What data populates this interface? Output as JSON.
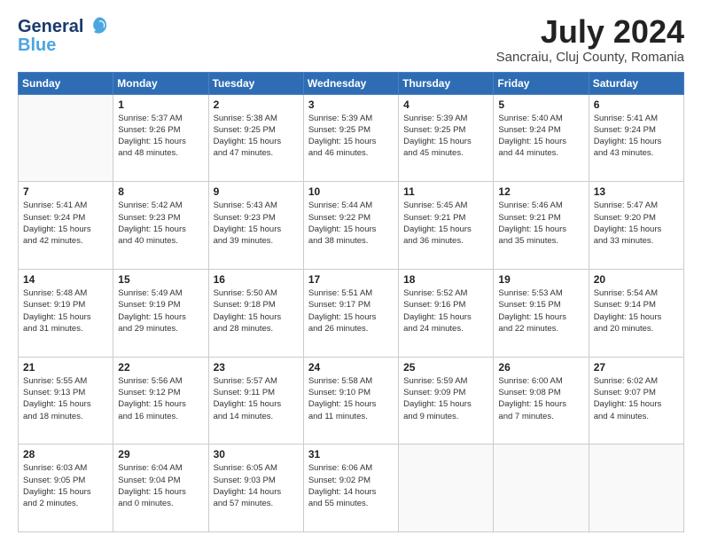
{
  "logo": {
    "line1": "General",
    "line2": "Blue"
  },
  "title": "July 2024",
  "subtitle": "Sancraiu, Cluj County, Romania",
  "headers": [
    "Sunday",
    "Monday",
    "Tuesday",
    "Wednesday",
    "Thursday",
    "Friday",
    "Saturday"
  ],
  "weeks": [
    [
      {
        "num": "",
        "info": ""
      },
      {
        "num": "1",
        "info": "Sunrise: 5:37 AM\nSunset: 9:26 PM\nDaylight: 15 hours\nand 48 minutes."
      },
      {
        "num": "2",
        "info": "Sunrise: 5:38 AM\nSunset: 9:25 PM\nDaylight: 15 hours\nand 47 minutes."
      },
      {
        "num": "3",
        "info": "Sunrise: 5:39 AM\nSunset: 9:25 PM\nDaylight: 15 hours\nand 46 minutes."
      },
      {
        "num": "4",
        "info": "Sunrise: 5:39 AM\nSunset: 9:25 PM\nDaylight: 15 hours\nand 45 minutes."
      },
      {
        "num": "5",
        "info": "Sunrise: 5:40 AM\nSunset: 9:24 PM\nDaylight: 15 hours\nand 44 minutes."
      },
      {
        "num": "6",
        "info": "Sunrise: 5:41 AM\nSunset: 9:24 PM\nDaylight: 15 hours\nand 43 minutes."
      }
    ],
    [
      {
        "num": "7",
        "info": "Sunrise: 5:41 AM\nSunset: 9:24 PM\nDaylight: 15 hours\nand 42 minutes."
      },
      {
        "num": "8",
        "info": "Sunrise: 5:42 AM\nSunset: 9:23 PM\nDaylight: 15 hours\nand 40 minutes."
      },
      {
        "num": "9",
        "info": "Sunrise: 5:43 AM\nSunset: 9:23 PM\nDaylight: 15 hours\nand 39 minutes."
      },
      {
        "num": "10",
        "info": "Sunrise: 5:44 AM\nSunset: 9:22 PM\nDaylight: 15 hours\nand 38 minutes."
      },
      {
        "num": "11",
        "info": "Sunrise: 5:45 AM\nSunset: 9:21 PM\nDaylight: 15 hours\nand 36 minutes."
      },
      {
        "num": "12",
        "info": "Sunrise: 5:46 AM\nSunset: 9:21 PM\nDaylight: 15 hours\nand 35 minutes."
      },
      {
        "num": "13",
        "info": "Sunrise: 5:47 AM\nSunset: 9:20 PM\nDaylight: 15 hours\nand 33 minutes."
      }
    ],
    [
      {
        "num": "14",
        "info": "Sunrise: 5:48 AM\nSunset: 9:19 PM\nDaylight: 15 hours\nand 31 minutes."
      },
      {
        "num": "15",
        "info": "Sunrise: 5:49 AM\nSunset: 9:19 PM\nDaylight: 15 hours\nand 29 minutes."
      },
      {
        "num": "16",
        "info": "Sunrise: 5:50 AM\nSunset: 9:18 PM\nDaylight: 15 hours\nand 28 minutes."
      },
      {
        "num": "17",
        "info": "Sunrise: 5:51 AM\nSunset: 9:17 PM\nDaylight: 15 hours\nand 26 minutes."
      },
      {
        "num": "18",
        "info": "Sunrise: 5:52 AM\nSunset: 9:16 PM\nDaylight: 15 hours\nand 24 minutes."
      },
      {
        "num": "19",
        "info": "Sunrise: 5:53 AM\nSunset: 9:15 PM\nDaylight: 15 hours\nand 22 minutes."
      },
      {
        "num": "20",
        "info": "Sunrise: 5:54 AM\nSunset: 9:14 PM\nDaylight: 15 hours\nand 20 minutes."
      }
    ],
    [
      {
        "num": "21",
        "info": "Sunrise: 5:55 AM\nSunset: 9:13 PM\nDaylight: 15 hours\nand 18 minutes."
      },
      {
        "num": "22",
        "info": "Sunrise: 5:56 AM\nSunset: 9:12 PM\nDaylight: 15 hours\nand 16 minutes."
      },
      {
        "num": "23",
        "info": "Sunrise: 5:57 AM\nSunset: 9:11 PM\nDaylight: 15 hours\nand 14 minutes."
      },
      {
        "num": "24",
        "info": "Sunrise: 5:58 AM\nSunset: 9:10 PM\nDaylight: 15 hours\nand 11 minutes."
      },
      {
        "num": "25",
        "info": "Sunrise: 5:59 AM\nSunset: 9:09 PM\nDaylight: 15 hours\nand 9 minutes."
      },
      {
        "num": "26",
        "info": "Sunrise: 6:00 AM\nSunset: 9:08 PM\nDaylight: 15 hours\nand 7 minutes."
      },
      {
        "num": "27",
        "info": "Sunrise: 6:02 AM\nSunset: 9:07 PM\nDaylight: 15 hours\nand 4 minutes."
      }
    ],
    [
      {
        "num": "28",
        "info": "Sunrise: 6:03 AM\nSunset: 9:05 PM\nDaylight: 15 hours\nand 2 minutes."
      },
      {
        "num": "29",
        "info": "Sunrise: 6:04 AM\nSunset: 9:04 PM\nDaylight: 15 hours\nand 0 minutes."
      },
      {
        "num": "30",
        "info": "Sunrise: 6:05 AM\nSunset: 9:03 PM\nDaylight: 14 hours\nand 57 minutes."
      },
      {
        "num": "31",
        "info": "Sunrise: 6:06 AM\nSunset: 9:02 PM\nDaylight: 14 hours\nand 55 minutes."
      },
      {
        "num": "",
        "info": ""
      },
      {
        "num": "",
        "info": ""
      },
      {
        "num": "",
        "info": ""
      }
    ]
  ]
}
